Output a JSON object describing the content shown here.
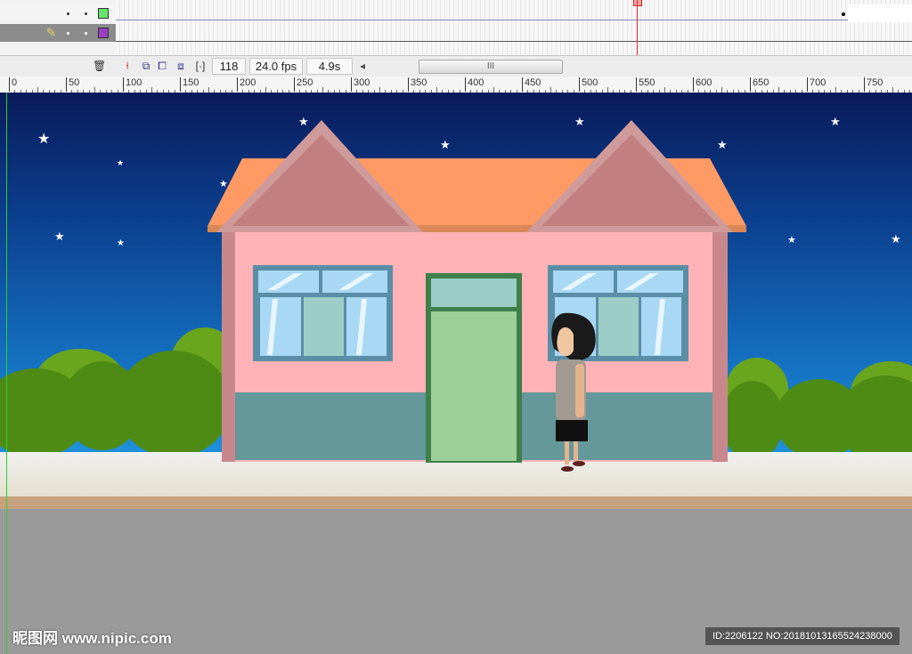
{
  "timeline": {
    "layers": [
      {
        "color": "#66e36a"
      },
      {
        "color": "#9b3fc3"
      }
    ],
    "current_frame": "118",
    "frame_rate": "24.0 fps",
    "elapsed_time": "4.9s",
    "scroll_thumb": "III",
    "scroll_left": "◂"
  },
  "ruler": {
    "labels": [
      "0",
      "50",
      "100",
      "150",
      "200",
      "250",
      "300",
      "350",
      "400",
      "450",
      "500",
      "550",
      "600",
      "650",
      "700",
      "750"
    ]
  },
  "watermark": {
    "site": "昵图网 www.nipic.com",
    "id_text": "ID:2206122 NO:20181013165524238000"
  },
  "colors": {
    "sky_top": "#0a1a5a",
    "sky_bottom": "#1e8fd8",
    "wall": "#ffb3b7",
    "roof": "#ff9a64",
    "gable": "#c27f80",
    "door": "#9ecf9a",
    "wainscot": "#64989a"
  }
}
